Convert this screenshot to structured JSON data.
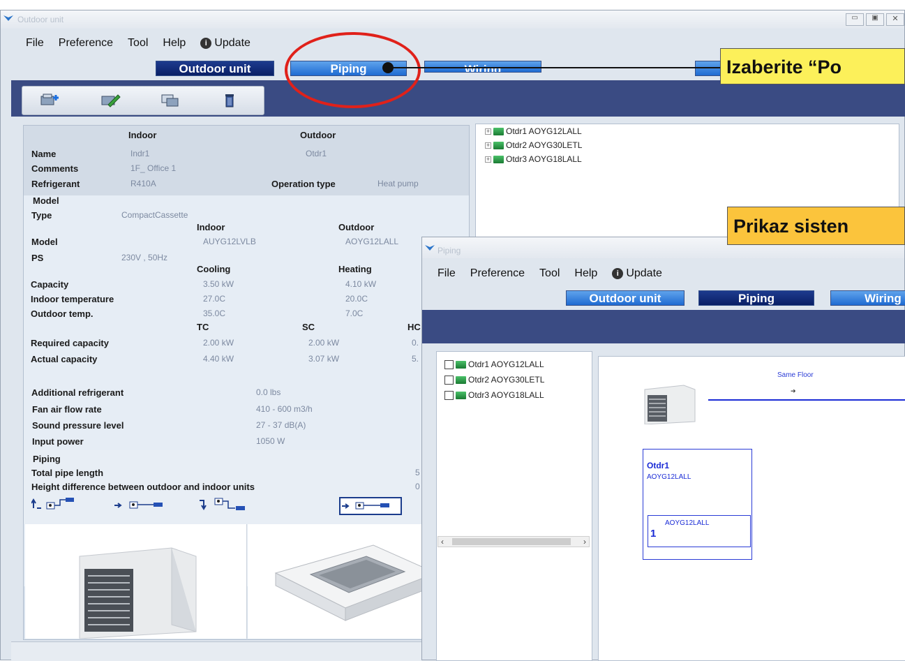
{
  "main_window": {
    "title": "Outdoor unit",
    "menu": [
      "File",
      "Preference",
      "Tool",
      "Help",
      "Update"
    ],
    "nav": {
      "outdoor_unit": "Outdoor unit",
      "piping": "Piping",
      "wiring": "Wiring"
    },
    "toolbar": [
      "add-unit-icon",
      "edit-icon",
      "copy-icon",
      "delete-icon"
    ],
    "summary": {
      "indoor_header": "Indoor",
      "outdoor_header": "Outdoor",
      "name_label": "Name",
      "name_indoor": "Indr1",
      "name_outdoor": "Otdr1",
      "comments_label": "Comments",
      "comments_value": "1F_ Office 1",
      "refrigerant_label": "Refrigerant",
      "refrigerant_value": "R410A",
      "operation_type_label": "Operation type",
      "operation_type_value": "Heat pump"
    },
    "model": {
      "section": "Model",
      "type_label": "Type",
      "type_value": "CompactCassette",
      "indoor_header": "Indoor",
      "outdoor_header": "Outdoor",
      "model_label": "Model",
      "model_indoor": "AUYG12LVLB",
      "model_outdoor": "AOYG12LALL",
      "ps_label": "PS",
      "ps_value": "230V , 50Hz",
      "cooling": "Cooling",
      "heating": "Heating",
      "capacity_label": "Capacity",
      "capacity_cool": "3.50 kW",
      "capacity_heat": "4.10 kW",
      "indoor_temp_label": "Indoor temperature",
      "indoor_temp_cool": "27.0C",
      "indoor_temp_heat": "20.0C",
      "outdoor_temp_label": "Outdoor temp.",
      "outdoor_temp_cool": "35.0C",
      "outdoor_temp_heat": "7.0C",
      "tc": "TC",
      "sc": "SC",
      "hc": "HC",
      "required_label": "Required capacity",
      "required_tc": "2.00 kW",
      "required_sc": "2.00 kW",
      "required_hc": "0.",
      "actual_label": "Actual capacity",
      "actual_tc": "4.40 kW",
      "actual_sc": "3.07 kW",
      "actual_hc": "5.",
      "add_ref_label": "Additional refrigerant",
      "add_ref_value": "0.0 lbs",
      "fan_label": "Fan air flow rate",
      "fan_value": "410 - 600 m3/h",
      "sound_label": "Sound pressure level",
      "sound_value": "27 - 37 dB(A)",
      "power_label": "Input power",
      "power_value": "1050 W"
    },
    "piping": {
      "section": "Piping",
      "total_label": "Total pipe length",
      "total_value": "5",
      "height_label": "Height difference between outdoor and indoor units",
      "height_value": "0"
    },
    "tree": [
      "Otdr1  AOYG12LALL",
      "Otdr2  AOYG30LETL",
      "Otdr3  AOYG18LALL"
    ]
  },
  "piping_window": {
    "title": "Piping",
    "menu": [
      "File",
      "Preference",
      "Tool",
      "Help",
      "Update"
    ],
    "nav": {
      "outdoor_unit": "Outdoor unit",
      "piping": "Piping",
      "wiring": "Wiring"
    },
    "list": [
      "Otdr1 AOYG12LALL",
      "Otdr2 AOYG30LETL",
      "Otdr3 AOYG18LALL"
    ],
    "diagram": {
      "floor_label": "Same Floor",
      "unit_name": "Otdr1",
      "unit_model": "AOYG12LALL",
      "sub_model": "AOYG12LALL",
      "sub_index": "1"
    }
  },
  "callouts": {
    "top": "Izaberite “Po",
    "middle": "Prikaz sisten"
  },
  "colors": {
    "nav_dark": "#0a1f66",
    "nav_light": "#1f6bd2",
    "band": "#3a4b83",
    "callout": "#fcf05a",
    "highlight": "#e0211a",
    "diagram_blue": "#1a2bd6"
  }
}
